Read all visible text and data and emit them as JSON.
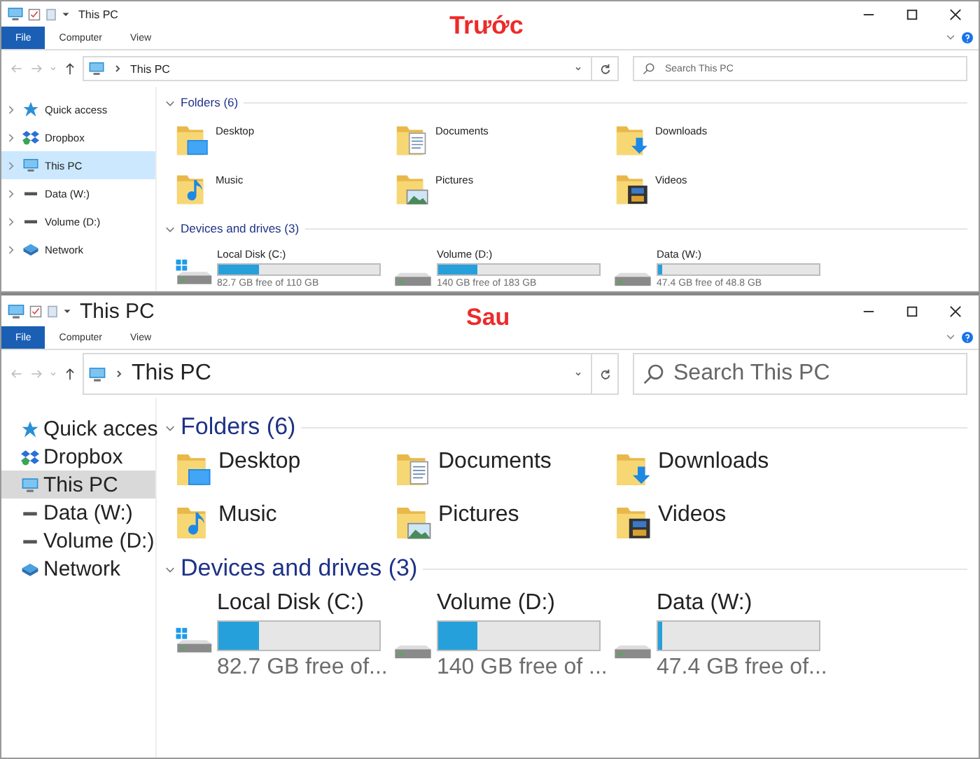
{
  "windows": [
    {
      "kind": "normal",
      "title": "This PC",
      "annotation": "Trước",
      "tabs": [
        {
          "label": "File",
          "selected": true
        },
        {
          "label": "Computer",
          "selected": false
        },
        {
          "label": "View",
          "selected": false
        }
      ],
      "address": "This PC",
      "search": {
        "placeholder": "Search This PC"
      },
      "sidebar": [
        {
          "label": "Quick access",
          "kind": "star",
          "selected": false
        },
        {
          "label": "Dropbox",
          "kind": "dropbox",
          "selected": false
        },
        {
          "label": "This PC",
          "kind": "pc",
          "selected": true
        },
        {
          "label": "Data (W:)",
          "kind": "drive",
          "selected": false
        },
        {
          "label": "Volume (D:)",
          "kind": "drive",
          "selected": false
        },
        {
          "label": "Network",
          "kind": "network",
          "selected": false
        }
      ],
      "folders": {
        "title": "Folders (6)",
        "expanded": true,
        "items": [
          {
            "name": "Desktop",
            "kind": "desktop"
          },
          {
            "name": "Documents",
            "kind": "documents"
          },
          {
            "name": "Downloads",
            "kind": "downloads"
          },
          {
            "name": "Music",
            "kind": "music"
          },
          {
            "name": "Pictures",
            "kind": "pictures"
          },
          {
            "name": "Videos",
            "kind": "videos"
          }
        ]
      },
      "drives": {
        "title": "Devices and drives (3)",
        "expanded": true,
        "items": [
          {
            "name": "Local Disk (C:)",
            "kind": "system",
            "level": 0.25,
            "free": "82.7 GB free of 110 GB"
          },
          {
            "name": "Volume (D:)",
            "kind": "drive",
            "level": 0.24,
            "free": "140 GB free of 183 GB"
          },
          {
            "name": "Data (W:)",
            "kind": "drive",
            "level": 0.03,
            "free": "47.4 GB free of 48.8 GB"
          }
        ]
      }
    },
    {
      "kind": "large",
      "title": "This PC",
      "annotation": "Sau",
      "tabs": [
        {
          "label": "File",
          "selected": true
        },
        {
          "label": "Computer",
          "selected": false
        },
        {
          "label": "View",
          "selected": false
        }
      ],
      "address": "This PC",
      "search": {
        "placeholder": "Search This PC"
      },
      "sidebar": [
        {
          "label": "Quick acces",
          "kind": "star",
          "selected": false
        },
        {
          "label": "Dropbox",
          "kind": "dropbox",
          "selected": false
        },
        {
          "label": "This PC",
          "kind": "pc",
          "selected": true
        },
        {
          "label": "Data (W:)",
          "kind": "drive",
          "selected": false
        },
        {
          "label": "Volume (D:)",
          "kind": "drive",
          "selected": false
        },
        {
          "label": "Network",
          "kind": "network",
          "selected": false
        }
      ],
      "folders": {
        "title": "Folders (6)",
        "expanded": true,
        "items": [
          {
            "name": "Desktop",
            "kind": "desktop"
          },
          {
            "name": "Documents",
            "kind": "documents"
          },
          {
            "name": "Downloads",
            "kind": "downloads"
          },
          {
            "name": "Music",
            "kind": "music"
          },
          {
            "name": "Pictures",
            "kind": "pictures"
          },
          {
            "name": "Videos",
            "kind": "videos"
          }
        ]
      },
      "drives": {
        "title": "Devices and drives (3)",
        "expanded": true,
        "items": [
          {
            "name": "Local Disk (C:)",
            "kind": "system",
            "level": 0.25,
            "free": "82.7 GB free of..."
          },
          {
            "name": "Volume (D:)",
            "kind": "drive",
            "level": 0.24,
            "free": "140 GB free of ..."
          },
          {
            "name": "Data (W:)",
            "kind": "drive",
            "level": 0.03,
            "free": "47.4 GB free of..."
          }
        ]
      }
    }
  ]
}
